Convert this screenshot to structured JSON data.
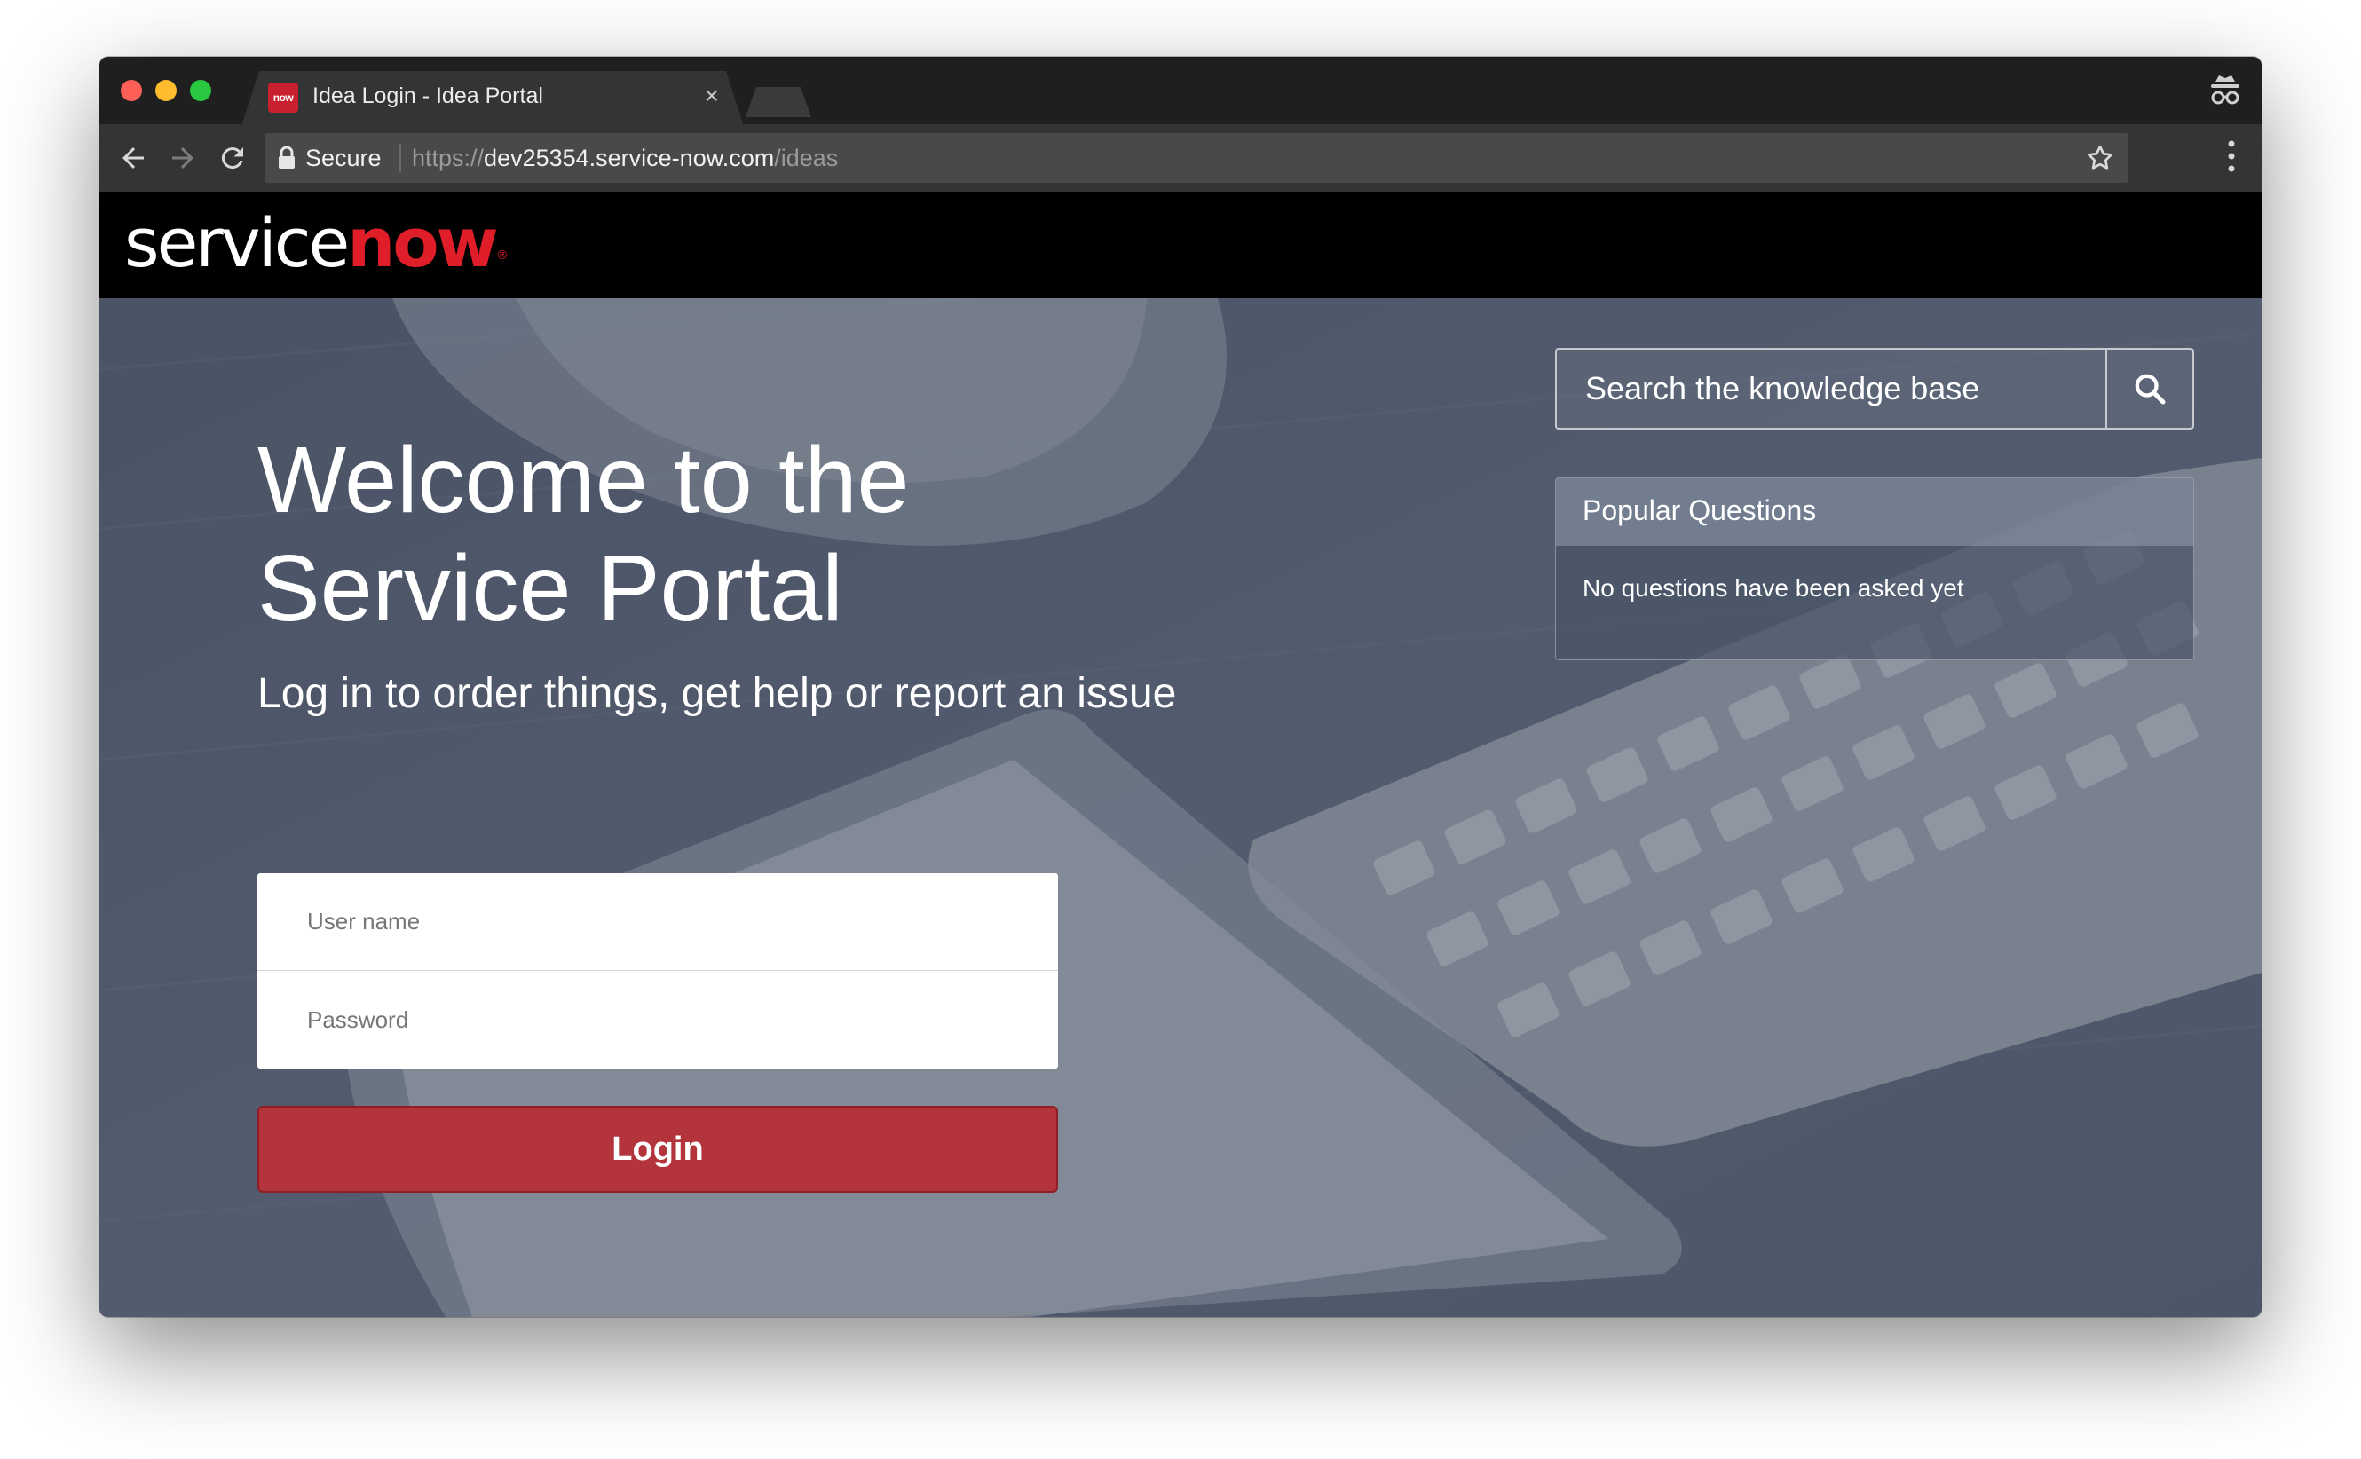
{
  "browser": {
    "tab": {
      "favicon_text": "now",
      "title": "Idea Login - Idea Portal",
      "close_glyph": "×"
    },
    "address_bar": {
      "security_label": "Secure",
      "url_scheme": "https://",
      "url_host": "dev25354.service-now.com",
      "url_path": "/ideas"
    },
    "icons": [
      "back-arrow-icon",
      "forward-arrow-icon",
      "reload-icon",
      "lock-icon",
      "bookmark-star-icon",
      "more-menu-icon",
      "incognito-icon"
    ]
  },
  "header": {
    "logo_service": "service",
    "logo_now": "now",
    "logo_reg": "®"
  },
  "hero": {
    "title": "Welcome to the Service Portal",
    "subtitle": "Log in to order things, get help or report an issue"
  },
  "login": {
    "username_placeholder": "User name",
    "password_placeholder": "Password",
    "button_label": "Login"
  },
  "search": {
    "placeholder": "Search the knowledge base",
    "icon": "search-icon"
  },
  "popular_questions": {
    "heading": "Popular Questions",
    "empty_message": "No questions have been asked yet"
  },
  "colors": {
    "brand_red": "#e01e2a",
    "login_button": "#b3343b",
    "header_bg": "#000000",
    "overlay": "#5b6474"
  }
}
